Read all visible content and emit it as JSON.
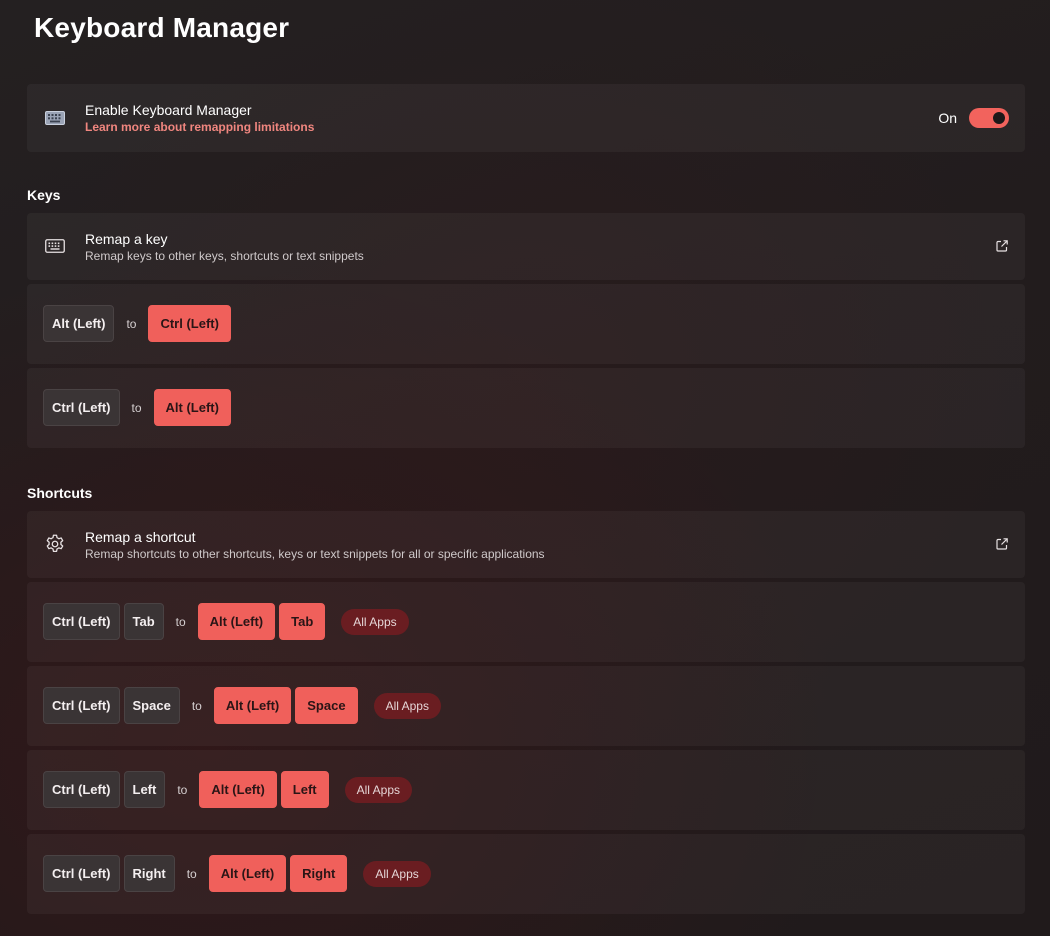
{
  "page": {
    "title": "Keyboard Manager"
  },
  "enable": {
    "title": "Enable Keyboard Manager",
    "link": "Learn more about remapping limitations",
    "state": "On",
    "enabled": true,
    "icon": "keyboard-icon"
  },
  "keys": {
    "heading": "Keys",
    "header": {
      "title": "Remap a key",
      "description": "Remap keys to other keys, shortcuts or text snippets",
      "icon": "keyboard-icon",
      "action_icon": "open-external-icon"
    },
    "mappings": [
      {
        "from": [
          "Alt (Left)"
        ],
        "to_label": "to",
        "to": [
          "Ctrl (Left)"
        ]
      },
      {
        "from": [
          "Ctrl (Left)"
        ],
        "to_label": "to",
        "to": [
          "Alt (Left)"
        ]
      }
    ]
  },
  "shortcuts": {
    "heading": "Shortcuts",
    "header": {
      "title": "Remap a shortcut",
      "description": "Remap shortcuts to other shortcuts, keys or text snippets for all or specific applications",
      "icon": "gear-icon",
      "action_icon": "open-external-icon"
    },
    "mappings": [
      {
        "from": [
          "Ctrl (Left)",
          "Tab"
        ],
        "to_label": "to",
        "to": [
          "Alt (Left)",
          "Tab"
        ],
        "app": "All Apps"
      },
      {
        "from": [
          "Ctrl (Left)",
          "Space"
        ],
        "to_label": "to",
        "to": [
          "Alt (Left)",
          "Space"
        ],
        "app": "All Apps"
      },
      {
        "from": [
          "Ctrl (Left)",
          "Left"
        ],
        "to_label": "to",
        "to": [
          "Alt (Left)",
          "Left"
        ],
        "app": "All Apps"
      },
      {
        "from": [
          "Ctrl (Left)",
          "Right"
        ],
        "to_label": "to",
        "to": [
          "Alt (Left)",
          "Right"
        ],
        "app": "All Apps"
      }
    ]
  },
  "colors": {
    "accent": "#f0605b",
    "app_badge": "#6a1d21",
    "link": "#f0867f"
  }
}
